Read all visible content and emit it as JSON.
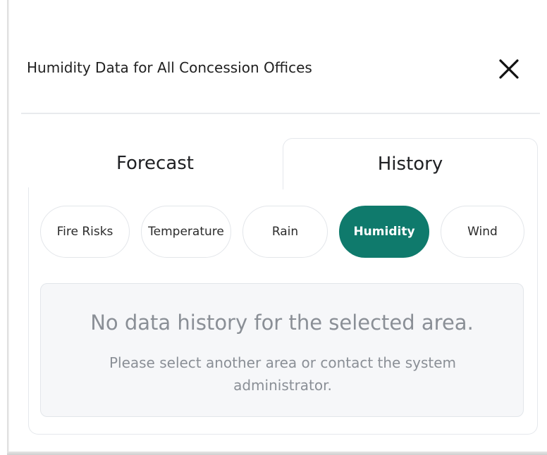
{
  "header": {
    "title": "Humidity Data for All Concession Offices",
    "close_icon": "close-icon"
  },
  "tabs": [
    {
      "label": "Forecast",
      "active": false
    },
    {
      "label": "History",
      "active": true
    }
  ],
  "filters": [
    {
      "label": "Fire Risks",
      "active": false
    },
    {
      "label": "Temperature",
      "active": false
    },
    {
      "label": "Rain",
      "active": false
    },
    {
      "label": "Humidity",
      "active": true
    },
    {
      "label": "Wind",
      "active": false
    }
  ],
  "empty_state": {
    "title": "No data history for the selected area.",
    "message": "Please select another area or contact the system administrator."
  },
  "colors": {
    "accent": "#0f7a6c",
    "muted_text": "#8a8f96"
  }
}
